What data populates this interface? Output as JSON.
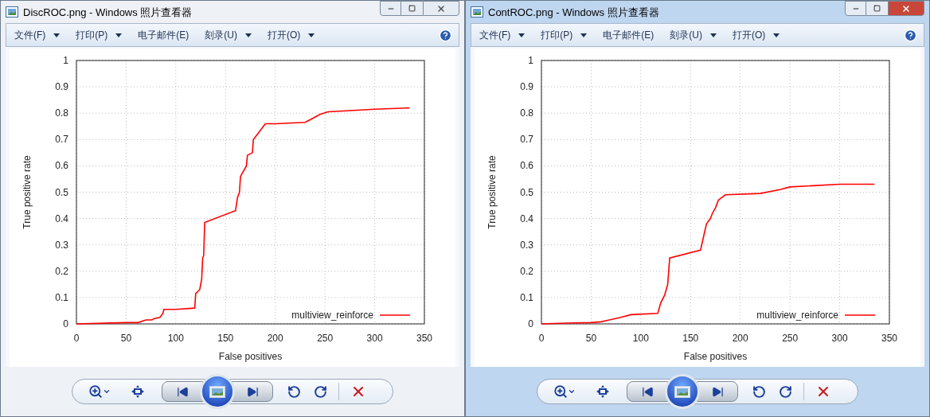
{
  "windows": [
    {
      "title": "DiscROC.png - Windows 照片查看器",
      "active": false,
      "menu": [
        {
          "label": "文件(F)",
          "dropdown": true
        },
        {
          "label": "打印(P)",
          "dropdown": true
        },
        {
          "label": "电子邮件(E)",
          "dropdown": false
        },
        {
          "label": "刻录(U)",
          "dropdown": true
        },
        {
          "label": "打开(O)",
          "dropdown": true
        }
      ],
      "chart_data": {
        "type": "line",
        "grid": true,
        "xlabel": "False positives",
        "ylabel": "True positive rate",
        "xlim": [
          0,
          350
        ],
        "ylim": [
          0,
          1
        ],
        "xticks": [
          0,
          50,
          100,
          150,
          200,
          250,
          300,
          350
        ],
        "yticks": [
          0,
          0.1,
          0.2,
          0.3,
          0.4,
          0.5,
          0.6,
          0.7,
          0.8,
          0.9,
          1
        ],
        "x": [
          0,
          50,
          62,
          70,
          76,
          78,
          84,
          87,
          88,
          100,
          119,
          120,
          124,
          126,
          127,
          128,
          129,
          160,
          162,
          164,
          165,
          171,
          172,
          177,
          178,
          182,
          190,
          200,
          230,
          235,
          245,
          253,
          300,
          335
        ],
        "series": [
          {
            "name": "multiview_reinforce",
            "color": "#ff0000",
            "values": [
              0,
              0.005,
              0.005,
              0.015,
              0.015,
              0.02,
              0.025,
              0.04,
              0.055,
              0.055,
              0.06,
              0.115,
              0.13,
              0.17,
              0.25,
              0.26,
              0.385,
              0.43,
              0.48,
              0.5,
              0.56,
              0.6,
              0.64,
              0.65,
              0.7,
              0.72,
              0.76,
              0.76,
              0.765,
              0.775,
              0.795,
              0.805,
              0.815,
              0.82
            ]
          }
        ]
      }
    },
    {
      "title": "ContROC.png - Windows 照片查看器",
      "active": true,
      "menu": [
        {
          "label": "文件(F)",
          "dropdown": true
        },
        {
          "label": "打印(P)",
          "dropdown": true
        },
        {
          "label": "电子邮件(E)",
          "dropdown": false
        },
        {
          "label": "刻录(U)",
          "dropdown": true
        },
        {
          "label": "打开(O)",
          "dropdown": true
        }
      ],
      "chart_data": {
        "type": "line",
        "grid": true,
        "xlabel": "False positives",
        "ylabel": "True positive rate",
        "xlim": [
          0,
          350
        ],
        "ylim": [
          0,
          1
        ],
        "xticks": [
          0,
          50,
          100,
          150,
          200,
          250,
          300,
          350
        ],
        "yticks": [
          0,
          0.1,
          0.2,
          0.3,
          0.4,
          0.5,
          0.6,
          0.7,
          0.8,
          0.9,
          1
        ],
        "x": [
          0,
          25,
          50,
          60,
          80,
          90,
          117,
          120,
          124,
          127,
          129,
          160,
          163,
          166,
          170,
          172,
          175,
          178,
          185,
          220,
          240,
          250,
          300,
          335
        ],
        "series": [
          {
            "name": "multiview_reinforce",
            "color": "#ff0000",
            "values": [
              0,
              0.003,
              0.005,
              0.008,
              0.025,
              0.035,
              0.04,
              0.08,
              0.11,
              0.15,
              0.25,
              0.28,
              0.33,
              0.38,
              0.4,
              0.42,
              0.44,
              0.47,
              0.49,
              0.495,
              0.51,
              0.52,
              0.53,
              0.53
            ]
          }
        ]
      }
    }
  ]
}
